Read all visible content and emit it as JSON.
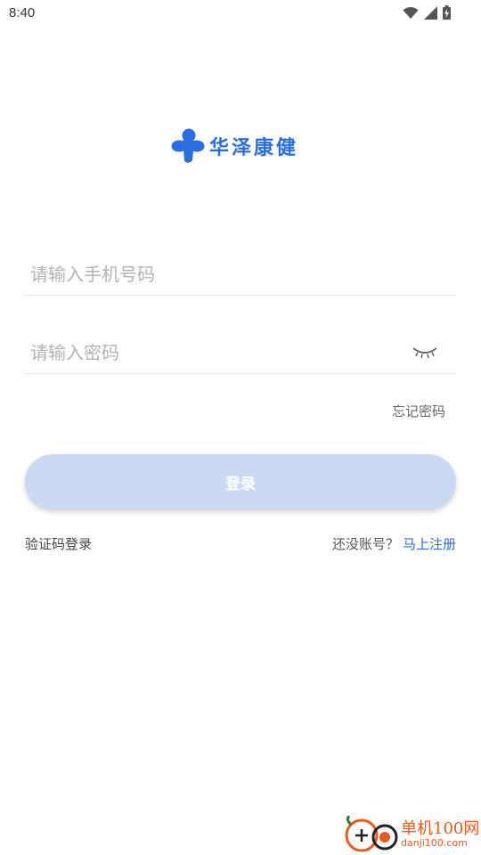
{
  "status_bar": {
    "time": "8:40",
    "icons": [
      "wifi-icon",
      "cellular-signal-icon",
      "battery-charging-icon"
    ]
  },
  "logo": {
    "text": "华泽康健",
    "icon": "cross-logo-icon",
    "brand_color": "#2a6ede"
  },
  "form": {
    "phone_placeholder": "请输入手机号码",
    "phone_value": "",
    "password_placeholder": "请输入密码",
    "password_value": "",
    "password_toggle_icon": "eye-closed-icon",
    "forgot_label": "忘记密码",
    "login_label": "登录",
    "login_button_color": "#cbd9f4"
  },
  "footer_links": {
    "sms_login_label": "验证码登录",
    "register_prompt": "还没账号？",
    "register_label": "马上注册",
    "link_color": "#2a6ede"
  },
  "watermark": {
    "title": "单机100网",
    "url": "danji100.com",
    "icon": "danji100-logo-icon",
    "color": "#e8581f"
  }
}
